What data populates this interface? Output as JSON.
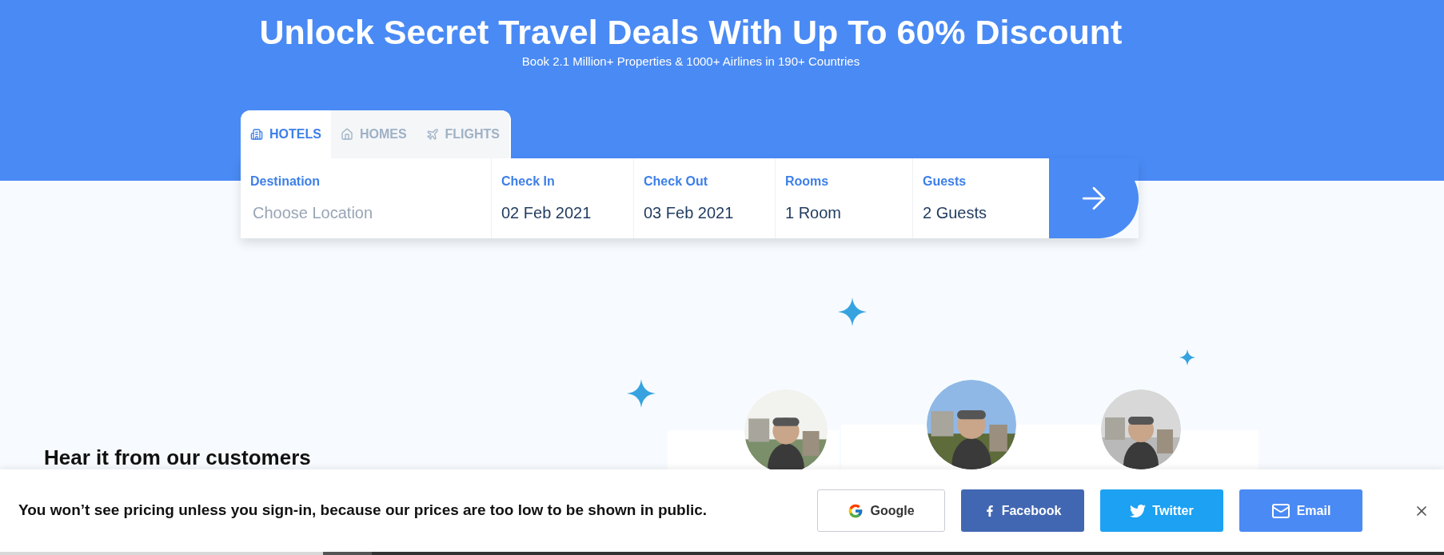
{
  "hero": {
    "title": "Unlock Secret Travel Deals With Up To 60% Discount",
    "subtitle": "Book 2.1 Million+ Properties & 1000+ Airlines in 190+ Countries"
  },
  "search": {
    "tabs": [
      {
        "label": "HOTELS",
        "kind": "hotel",
        "selected": true
      },
      {
        "label": "HOMES",
        "kind": "home",
        "selected": false
      },
      {
        "label": "FLIGHTS",
        "kind": "flight",
        "selected": false
      }
    ],
    "fields": [
      {
        "label": "Destination",
        "placeholder": "Choose Location"
      },
      {
        "label": "Check In",
        "value": "02 Feb 2021"
      },
      {
        "label": "Check Out",
        "value": "03 Feb 2021"
      },
      {
        "label": "Rooms",
        "value": "1 Room"
      },
      {
        "label": "Guests",
        "value": "2 Guests"
      }
    ]
  },
  "testimonials": {
    "heading": "Hear it from our customers"
  },
  "signin_bar": {
    "message": "You won’t see pricing unless you sign-in, because our prices are too low to be shown in public.",
    "buttons": [
      {
        "kind": "google",
        "label": "Google"
      },
      {
        "kind": "facebook",
        "label": "Facebook"
      },
      {
        "kind": "twitter",
        "label": "Twitter"
      },
      {
        "kind": "email",
        "label": "Email"
      }
    ]
  }
}
